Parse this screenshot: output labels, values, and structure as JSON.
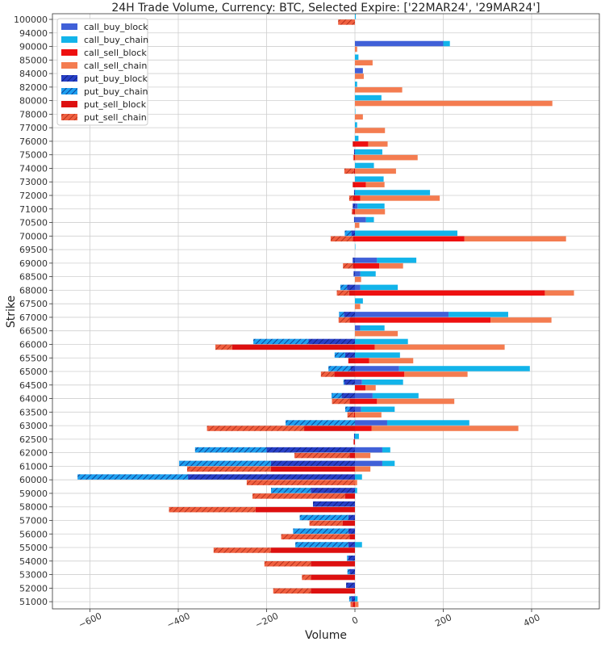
{
  "chart_data": {
    "type": "bar",
    "orientation": "horizontal",
    "stacked": true,
    "title": "24H Trade Volume, Currency: BTC, Selected Expire: ['22MAR24', '29MAR24']",
    "xlabel": "Volume",
    "ylabel": "Strike",
    "xlim": [
      -680,
      560
    ],
    "xticks": [
      -600,
      -400,
      -200,
      0,
      200,
      400
    ],
    "xtick_labels": [
      "−600",
      "−400",
      "−200",
      "0",
      "200",
      "400"
    ],
    "grid": true,
    "legend_position": "top-left",
    "categories": [
      "100000",
      "94000",
      "90000",
      "85000",
      "84000",
      "82000",
      "80000",
      "78000",
      "77000",
      "76000",
      "75000",
      "74000",
      "73000",
      "72000",
      "71000",
      "70500",
      "70000",
      "69500",
      "69000",
      "68500",
      "68000",
      "67500",
      "67000",
      "66500",
      "66000",
      "65500",
      "65000",
      "64500",
      "64000",
      "63500",
      "63000",
      "62500",
      "62000",
      "61000",
      "60000",
      "59000",
      "58000",
      "57000",
      "56000",
      "55000",
      "54000",
      "53000",
      "52000",
      "51000"
    ],
    "series": [
      {
        "name": "call_buy_block",
        "color": "#4060d8",
        "hatch": false,
        "side": "buy",
        "values": [
          0,
          0,
          200,
          0,
          18,
          0,
          0,
          0,
          0,
          0,
          0,
          0,
          0,
          0,
          6,
          25,
          0,
          0,
          50,
          12,
          12,
          0,
          212,
          12,
          0,
          0,
          100,
          16,
          40,
          14,
          73,
          0,
          62,
          62,
          0,
          0,
          0,
          0,
          0,
          0,
          0,
          0,
          0,
          0
        ]
      },
      {
        "name": "call_buy_chain",
        "color": "#12b4ea",
        "hatch": false,
        "side": "buy",
        "values": [
          2,
          0,
          15,
          8,
          0,
          5,
          60,
          1,
          5,
          8,
          62,
          43,
          65,
          170,
          61,
          18,
          232,
          1,
          89,
          35,
          85,
          18,
          135,
          55,
          120,
          102,
          296,
          93,
          104,
          76,
          186,
          9,
          18,
          28,
          16,
          5,
          0,
          0,
          0,
          16,
          0,
          0,
          0,
          6
        ]
      },
      {
        "name": "call_sell_block",
        "color": "#ee1010",
        "hatch": false,
        "side": "sell",
        "values": [
          0,
          0,
          0,
          0,
          0,
          0,
          0,
          0,
          0,
          30,
          0,
          0,
          25,
          12,
          0,
          0,
          248,
          0,
          55,
          0,
          430,
          0,
          307,
          0,
          45,
          32,
          112,
          24,
          50,
          0,
          38,
          0,
          0,
          0,
          0,
          0,
          0,
          0,
          0,
          0,
          0,
          0,
          0,
          0
        ]
      },
      {
        "name": "call_sell_chain",
        "color": "#f47c50",
        "hatch": false,
        "side": "sell",
        "values": [
          0,
          0,
          5,
          40,
          20,
          107,
          447,
          18,
          68,
          44,
          142,
          93,
          42,
          180,
          68,
          10,
          230,
          0,
          54,
          14,
          66,
          12,
          138,
          97,
          294,
          100,
          143,
          23,
          175,
          60,
          332,
          0,
          35,
          35,
          5,
          0,
          0,
          0,
          0,
          0,
          0,
          0,
          0,
          8
        ]
      },
      {
        "name": "put_buy_block",
        "color": "#2840c8",
        "hatch": true,
        "side": "buy",
        "values": [
          0,
          0,
          0,
          0,
          0,
          0,
          0,
          0,
          0,
          0,
          2,
          0,
          0,
          2,
          5,
          2,
          8,
          0,
          5,
          3,
          18,
          0,
          25,
          0,
          105,
          22,
          10,
          24,
          30,
          12,
          0,
          2,
          200,
          190,
          378,
          100,
          95,
          15,
          15,
          15,
          15,
          12,
          20,
          8
        ]
      },
      {
        "name": "put_buy_chain",
        "color": "#1ea0f0",
        "hatch": true,
        "side": "buy",
        "values": [
          0,
          0,
          0,
          0,
          0,
          0,
          0,
          0,
          0,
          0,
          0,
          0,
          0,
          0,
          0,
          0,
          15,
          0,
          0,
          0,
          15,
          0,
          11,
          0,
          125,
          24,
          50,
          2,
          23,
          10,
          157,
          0,
          162,
          208,
          250,
          90,
          0,
          110,
          125,
          120,
          3,
          5,
          0,
          5
        ]
      },
      {
        "name": "put_sell_block",
        "color": "#dd1010",
        "hatch": false,
        "side": "sell",
        "values": [
          0,
          0,
          0,
          0,
          0,
          0,
          0,
          0,
          0,
          5,
          2,
          2,
          5,
          5,
          5,
          0,
          5,
          0,
          5,
          0,
          13,
          0,
          12,
          0,
          278,
          15,
          47,
          0,
          12,
          2,
          115,
          3,
          12,
          190,
          0,
          22,
          225,
          28,
          12,
          190,
          100,
          100,
          100,
          5
        ]
      },
      {
        "name": "put_sell_chain",
        "color": "#f06040",
        "hatch": true,
        "side": "sell",
        "values": [
          38,
          0,
          0,
          0,
          0,
          0,
          0,
          0,
          0,
          0,
          2,
          22,
          0,
          8,
          2,
          0,
          50,
          0,
          22,
          0,
          28,
          0,
          25,
          0,
          38,
          0,
          30,
          0,
          40,
          15,
          220,
          0,
          125,
          190,
          245,
          210,
          196,
          75,
          155,
          130,
          105,
          20,
          85,
          5
        ]
      }
    ]
  }
}
